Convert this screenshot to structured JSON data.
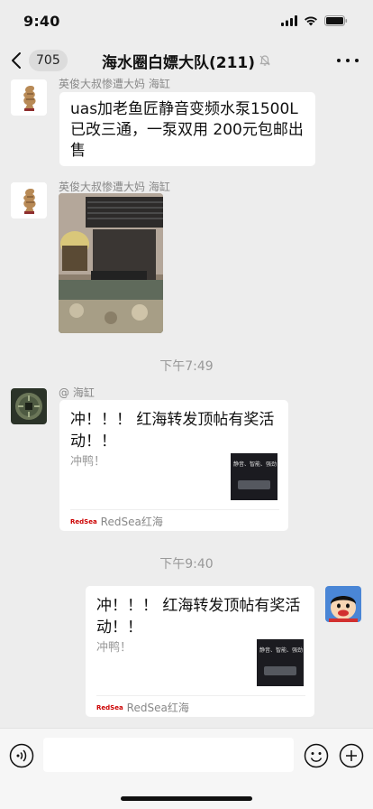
{
  "status": {
    "time": "9:40"
  },
  "nav": {
    "unread": "705",
    "title": "海水圈白嫖大队(211)"
  },
  "messages": [
    {
      "sender": "英俊大叔惨遭大妈 海缸",
      "text": "uas加老鱼匠静音变频水泵1500L已改三通，一泵双用 200元包邮出售"
    },
    {
      "sender": "英俊大叔惨遭大妈 海缸"
    },
    {
      "time": "下午7:49"
    },
    {
      "sender": "@ 海缸",
      "card_title": "冲！！！ 红海转发顶帖有奖活动！！",
      "card_desc": "冲鸭！",
      "source": "RedSea红海",
      "source_logo": "RedSea",
      "thumb_text": "静音、智能、强劲"
    },
    {
      "time": "下午9:40"
    },
    {
      "card_title": "冲！！！ 红海转发顶帖有奖活动！！",
      "card_desc": "冲鸭！",
      "source": "RedSea红海",
      "source_logo": "RedSea",
      "thumb_text": "静音、智能、强劲"
    }
  ],
  "icons": {
    "signal": "signal-icon",
    "wifi": "wifi-icon",
    "battery": "battery-icon",
    "back": "chevron-left-icon",
    "mute": "mute-icon",
    "more": "more-icon",
    "voice": "voice-icon",
    "emoji": "emoji-icon",
    "plus": "plus-icon"
  }
}
